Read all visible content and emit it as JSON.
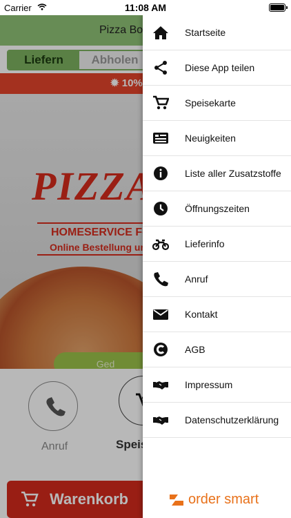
{
  "status": {
    "carrier": "Carrier",
    "time": "11:08 AM"
  },
  "app": {
    "title": "Pizza Bo",
    "toggle": {
      "deliver": "Liefern",
      "pickup": "Abholen"
    },
    "promo": "10%",
    "hero": {
      "brand": "PIZZA",
      "line1": "HOMESERVICE  For",
      "line2": "Online Bestellung unt",
      "order_button": "Ged"
    },
    "actions": {
      "call": "Anruf",
      "menu": "Speis"
    },
    "cart": "Warenkorb"
  },
  "drawer": {
    "items": [
      {
        "label": "Startseite",
        "icon": "home-icon"
      },
      {
        "label": "Diese App teilen",
        "icon": "share-icon"
      },
      {
        "label": "Speisekarte",
        "icon": "cart-icon"
      },
      {
        "label": "Neuigkeiten",
        "icon": "news-icon"
      },
      {
        "label": "Liste aller Zusatzstoffe",
        "icon": "info-icon"
      },
      {
        "label": "Öffnungszeiten",
        "icon": "clock-icon"
      },
      {
        "label": "Lieferinfo",
        "icon": "motorbike-icon"
      },
      {
        "label": "Anruf",
        "icon": "phone-icon"
      },
      {
        "label": "Kontakt",
        "icon": "envelope-icon"
      },
      {
        "label": "AGB",
        "icon": "copyright-icon"
      },
      {
        "label": "Impressum",
        "icon": "handshake-icon"
      },
      {
        "label": "Datenschutzerklärung",
        "icon": "handshake-icon"
      }
    ],
    "footer": "order smart"
  },
  "colors": {
    "accent_red": "#d42a1c",
    "accent_green": "#7db260",
    "brand_orange": "#e8711a"
  }
}
